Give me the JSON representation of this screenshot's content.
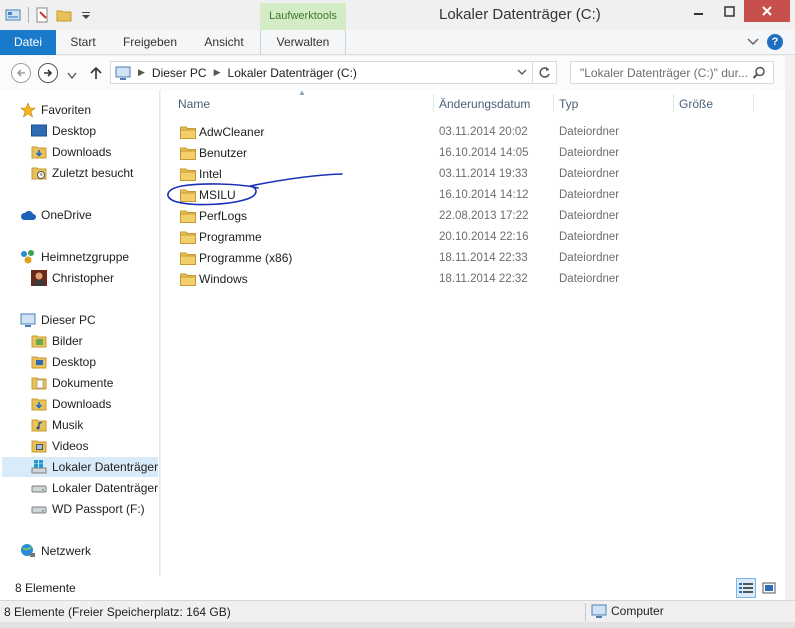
{
  "window": {
    "title": "Lokaler Datenträger (C:)",
    "context_tab": "Laufwerktools"
  },
  "ribbon": {
    "tabs": [
      "Datei",
      "Start",
      "Freigeben",
      "Ansicht",
      "Verwalten"
    ],
    "help": "?"
  },
  "address": {
    "segments": [
      "Dieser PC",
      "Lokaler Datenträger (C:)"
    ],
    "search_placeholder": "\"Lokaler Datenträger (C:)\" dur..."
  },
  "nav": {
    "favorites": {
      "label": "Favoriten",
      "items": [
        "Desktop",
        "Downloads",
        "Zuletzt besucht"
      ]
    },
    "onedrive": "OneDrive",
    "homegroup": {
      "label": "Heimnetzgruppe",
      "items": [
        "Christopher"
      ]
    },
    "thispc": {
      "label": "Dieser PC",
      "items": [
        "Bilder",
        "Desktop",
        "Dokumente",
        "Downloads",
        "Musik",
        "Videos",
        "Lokaler Datenträger",
        "Lokaler Datenträger",
        "WD Passport (F:)"
      ]
    },
    "network": "Netzwerk"
  },
  "columns": {
    "name": "Name",
    "date": "Änderungsdatum",
    "type": "Typ",
    "size": "Größe"
  },
  "files": [
    {
      "name": "AdwCleaner",
      "date": "03.11.2014 20:02",
      "type": "Dateiordner"
    },
    {
      "name": "Benutzer",
      "date": "16.10.2014 14:05",
      "type": "Dateiordner"
    },
    {
      "name": "Intel",
      "date": "03.11.2014 19:33",
      "type": "Dateiordner"
    },
    {
      "name": "MSILU",
      "date": "16.10.2014 14:12",
      "type": "Dateiordner"
    },
    {
      "name": "PerfLogs",
      "date": "22.08.2013 17:22",
      "type": "Dateiordner"
    },
    {
      "name": "Programme",
      "date": "20.10.2014 22:16",
      "type": "Dateiordner"
    },
    {
      "name": "Programme (x86)",
      "date": "18.11.2014 22:33",
      "type": "Dateiordner"
    },
    {
      "name": "Windows",
      "date": "18.11.2014 22:32",
      "type": "Dateiordner"
    }
  ],
  "footer": {
    "count": "8 Elemente",
    "status": "8 Elemente (Freier Speicherplatz: 164 GB)",
    "location": "Computer"
  },
  "colors": {
    "file_tab": "#1979ca",
    "context_tab": "#d3ecc5",
    "close_button": "#c7504d",
    "selection": "#d9ebf9",
    "folder": "#e8c15a",
    "scribble": "#1a2fb8"
  }
}
